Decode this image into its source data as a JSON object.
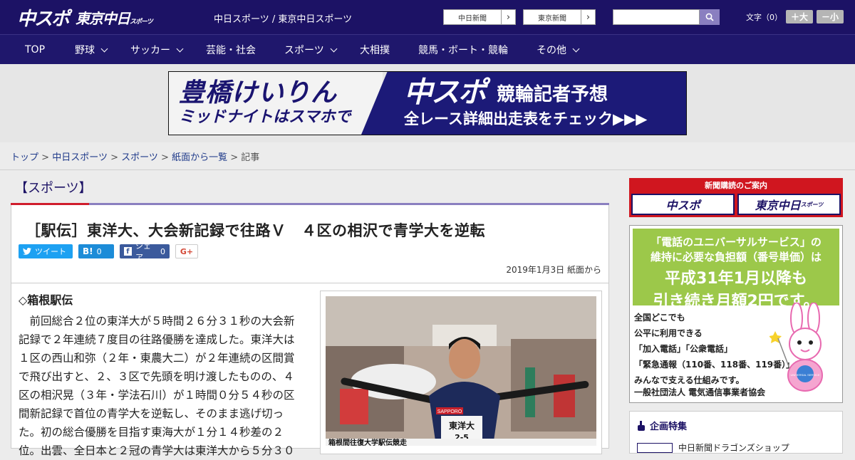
{
  "header": {
    "logo_primary": "中スポ",
    "logo_secondary": "東京中日",
    "logo_secondary_small": "スポーツ",
    "site_name": "中日スポーツ / 東京中日スポーツ",
    "ext_links": [
      "中日新聞",
      "東京新聞"
    ],
    "search_placeholder": "",
    "font_label": "文字（0）",
    "font_bigger": "＋大",
    "font_smaller": "－小"
  },
  "nav": {
    "items": [
      {
        "label": "TOP",
        "dropdown": false
      },
      {
        "label": "野球",
        "dropdown": true
      },
      {
        "label": "サッカー",
        "dropdown": true
      },
      {
        "label": "芸能・社会",
        "dropdown": false
      },
      {
        "label": "スポーツ",
        "dropdown": true
      },
      {
        "label": "大相撲",
        "dropdown": false
      },
      {
        "label": "競馬・ボート・競輪",
        "dropdown": false
      },
      {
        "label": "その他",
        "dropdown": true
      }
    ]
  },
  "banner": {
    "left_line1": "豊橋けいりん",
    "left_line2": "ミッドナイトはスマホで",
    "right_brand": "中スポ",
    "right_title": "競輪記者予想",
    "right_line2": "全レース詳細出走表をチェック▶▶▶"
  },
  "breadcrumb": {
    "items": [
      "トップ",
      "中日スポーツ",
      "スポーツ",
      "紙面から一覧"
    ],
    "current": "記事",
    "separator": ">"
  },
  "article": {
    "section": "【スポーツ】",
    "headline": "［駅伝］東洋大、大会新記録で往路Ｖ　４区の相沢で青学大を逆転",
    "share": {
      "tweet": "ツイート",
      "hatena_count": "0",
      "fb_label": "シェア",
      "fb_count": "0",
      "gplus": "G+"
    },
    "date": "2019年1月3日 紙面から",
    "subhead": "◇箱根駅伝",
    "body": "前回総合２位の東洋大が５時間２６分３１秒の大会新記録で２年連続７度目の往路優勝を達成した。東洋大は１区の西山和弥（２年・東農大二）が２年連続の区間賞で飛び出すと、２、３区で先頭を明け渡したものの、４区の相沢晃（３年・学法石川）が１時間０分５４秒の区間新記録で首位の青学大を逆転し、そのまま逃げ切った。初の総合優勝を目指す東海大が１分１４秒差の２位。出雲、全日本と２冠の青学大は東洋大から５分３０",
    "photo_caption_bib": "東洋大",
    "photo_caption_num": "2-5",
    "photo_sponsor": "SAPPORO",
    "photo_banner_text": "箱根間往復大学駅伝競走"
  },
  "sidebar": {
    "subscribe_title": "新聞購読のご案内",
    "subscribe_left": "中スポ",
    "subscribe_right": "東京中日",
    "subscribe_right_small": "スポーツ",
    "ad_lines_top": [
      "「電話のユニバーサルサービス」の",
      "維持に必要な負担額（番号単価）は",
      "平成31年1月以降も",
      "引き続き月額2円です。"
    ],
    "ad_lines_body": [
      "全国どこでも",
      "公平に利用できる",
      "「加入電話」「公衆電話」",
      "「緊急通報（110番、118番、119番）」を",
      "みんなで支える仕組みです。"
    ],
    "ad_footer": "一般社団法人 電気通信事業者協会",
    "rabbit_badge": "UNIVERSAL SERVICE",
    "feature_title": "企画特集",
    "feature_item": "中日新聞ドラゴンズショップ"
  },
  "colors": {
    "header_bg": "#1c1265",
    "nav_bg": "#1f176c",
    "accent_red": "#d01c2c",
    "accent_purple": "#8a7fc0",
    "ad_green": "#9cc84a"
  }
}
